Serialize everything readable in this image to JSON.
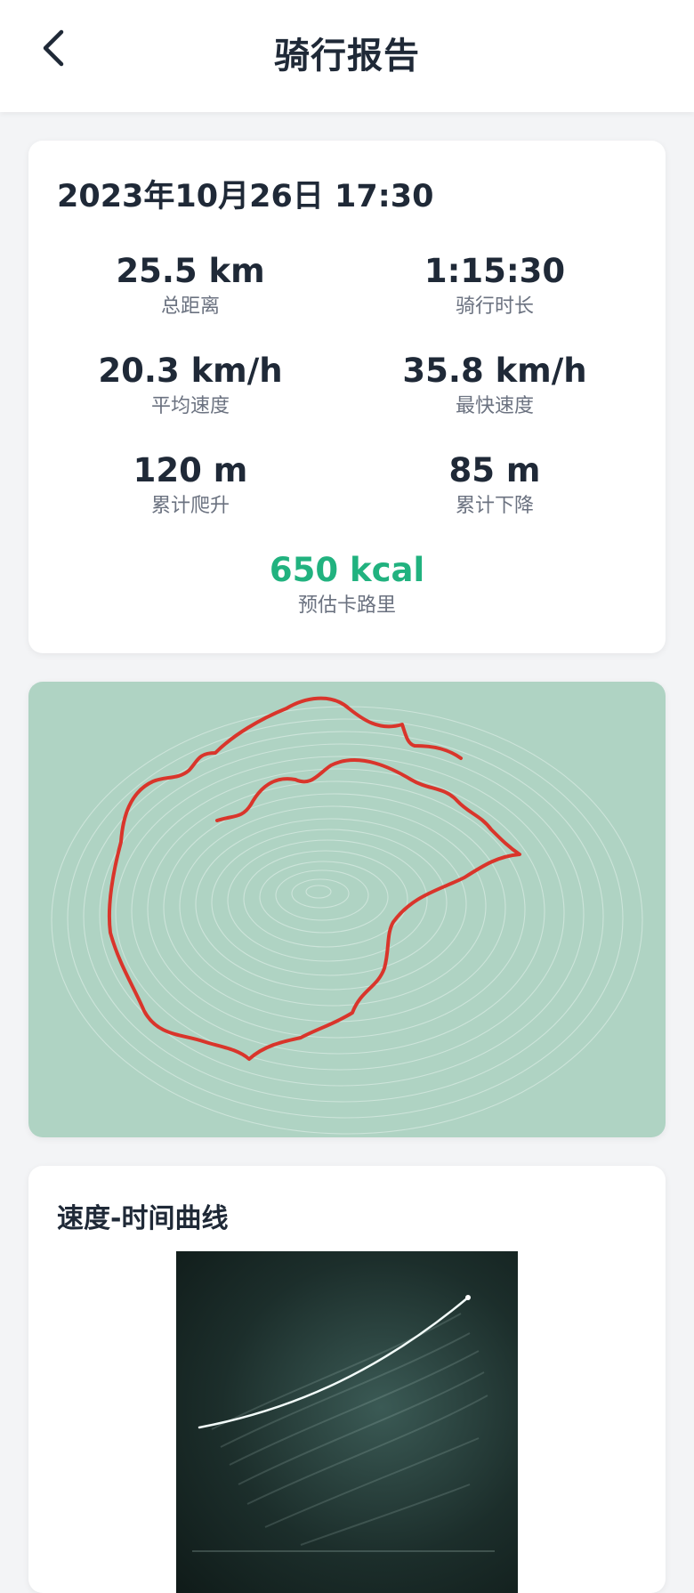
{
  "header": {
    "title": "骑行报告",
    "back_icon": "chevron-left-icon"
  },
  "summary": {
    "datetime": "2023年10月26日 17:30",
    "stats": {
      "distance": {
        "value": "25.5 km",
        "label": "总距离"
      },
      "duration": {
        "value": "1:15:30",
        "label": "骑行时长"
      },
      "avg_speed": {
        "value": "20.3 km/h",
        "label": "平均速度"
      },
      "max_speed": {
        "value": "35.8 km/h",
        "label": "最快速度"
      },
      "ascent": {
        "value": "120 m",
        "label": "累计爬升"
      },
      "descent": {
        "value": "85 m",
        "label": "累计下降"
      },
      "calories": {
        "value": "650 kcal",
        "label": "预估卡路里"
      }
    },
    "accent_color": "#21b27f"
  },
  "map": {
    "background_color": "#afd3c3",
    "route_color": "#d9352b",
    "contour_color": "#e6f2ec"
  },
  "speed_chart": {
    "title": "速度-时间曲线"
  }
}
